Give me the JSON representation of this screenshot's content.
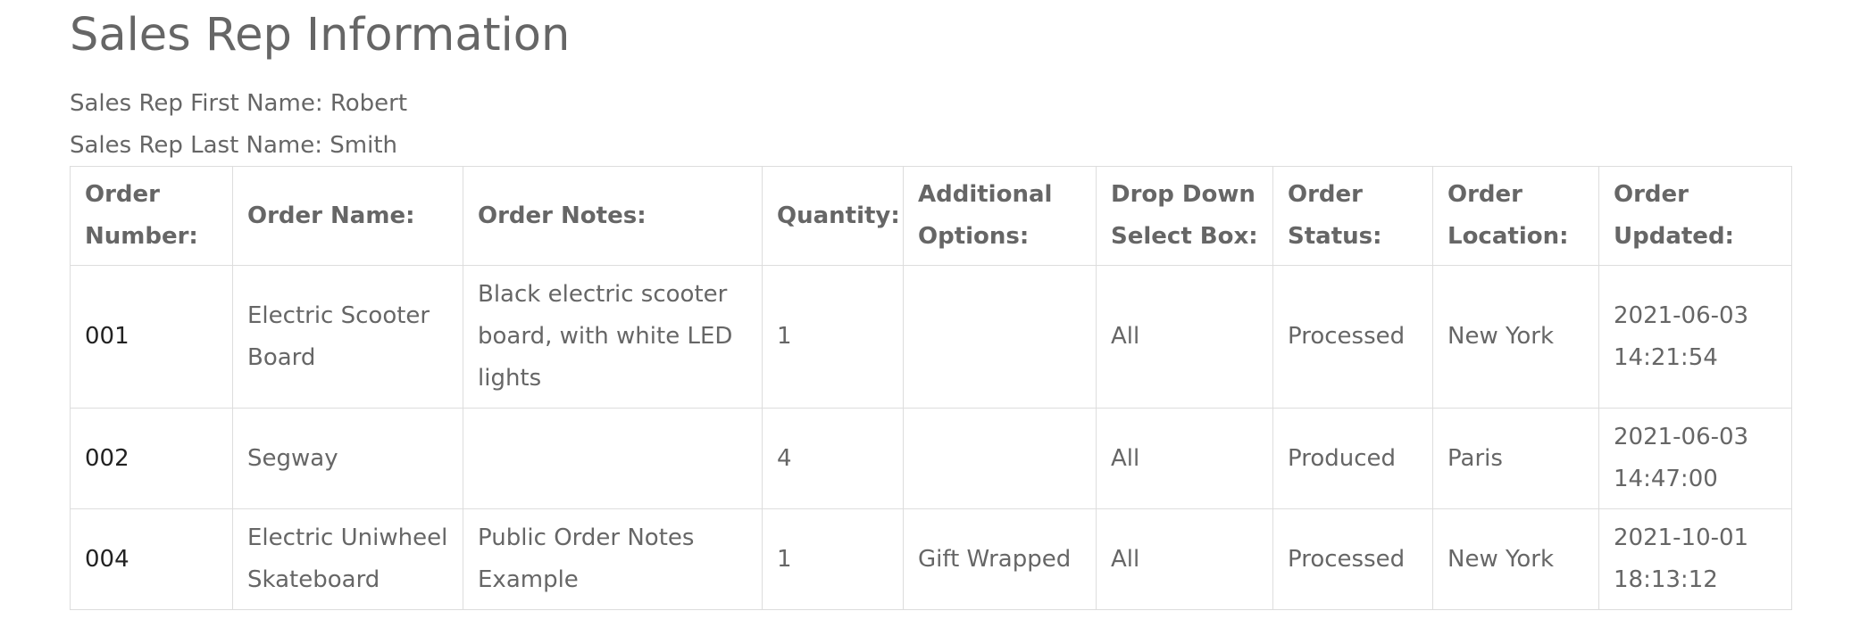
{
  "page": {
    "title": "Sales Rep Information",
    "first_name_line": "Sales Rep First Name: Robert",
    "last_name_line": "Sales Rep Last Name: Smith"
  },
  "table": {
    "headers": [
      "Order Number:",
      "Order Name:",
      "Order Notes:",
      "Quantity:",
      "Additional Options:",
      "Drop Down Select Box:",
      "Order Status:",
      "Order Location:",
      "Order Updated:"
    ],
    "rows": [
      {
        "order_number": "001",
        "order_name": "Electric Scooter Board",
        "order_notes": "Black electric scooter board, with white LED lights",
        "quantity": "1",
        "additional_options": "",
        "drop_down": "All",
        "status": "Processed",
        "location": "New York",
        "updated": "2021-06-03 14:21:54"
      },
      {
        "order_number": "002",
        "order_name": "Segway",
        "order_notes": "",
        "quantity": "4",
        "additional_options": "",
        "drop_down": "All",
        "status": "Produced",
        "location": "Paris",
        "updated": "2021-06-03 14:47:00"
      },
      {
        "order_number": "004",
        "order_name": "Electric Uniwheel Skateboard",
        "order_notes": "Public Order Notes Example",
        "quantity": "1",
        "additional_options": "Gift Wrapped",
        "drop_down": "All",
        "status": "Processed",
        "location": "New York",
        "updated": "2021-10-01 18:13:12"
      }
    ]
  }
}
